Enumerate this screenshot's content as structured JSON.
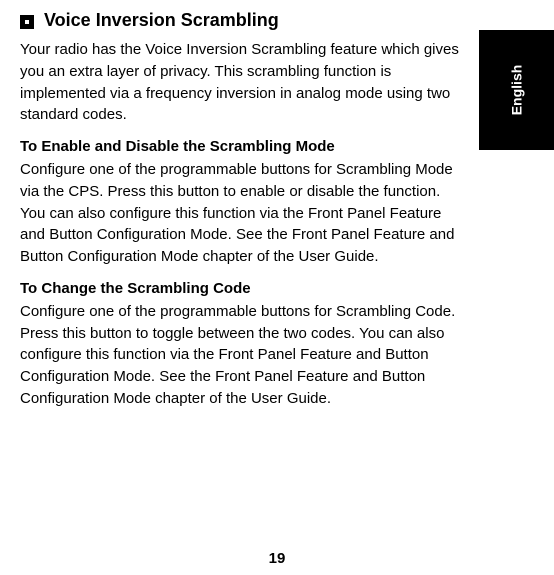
{
  "tab": {
    "language": "English"
  },
  "section": {
    "heading": "Voice Inversion Scrambling",
    "intro": "Your radio has the Voice Inversion Scrambling feature which gives you an extra layer of privacy. This scrambling function is implemented via a frequency inversion in analog mode using two standard codes.",
    "sub1": {
      "title": "To Enable and Disable the Scrambling Mode",
      "body": "Configure one of the programmable buttons for Scrambling Mode via the CPS. Press this button to enable or disable the function. You can also configure this function via the Front Panel Feature and Button Configuration Mode. See the Front Panel Feature and Button Configuration Mode chapter of the User Guide."
    },
    "sub2": {
      "title": "To Change the Scrambling Code",
      "body": "Configure one of the programmable buttons for Scrambling Code. Press this button to toggle between the two codes. You can also configure this function via the Front Panel Feature and Button Configuration Mode. See the Front Panel Feature and Button Configuration Mode chapter of the User Guide."
    }
  },
  "pageNumber": "19"
}
